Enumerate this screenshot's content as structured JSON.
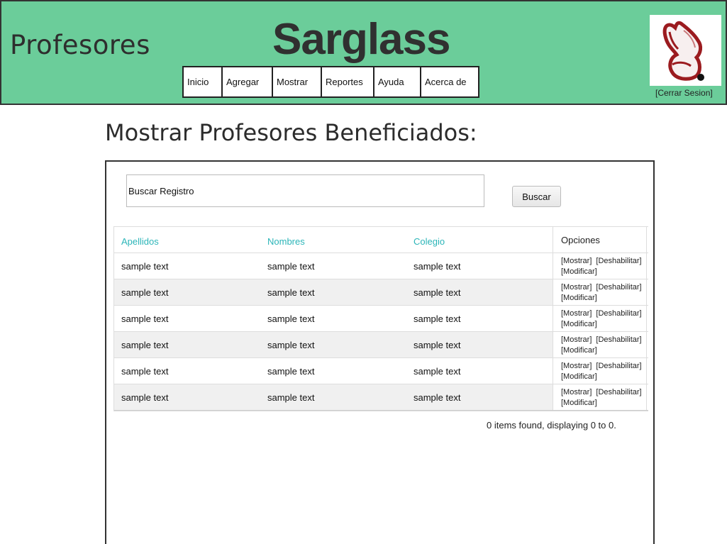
{
  "header": {
    "section_title": "Profesores",
    "brand": "Sarglass",
    "logout": "[Cerrar Sesion]",
    "nav": [
      {
        "label": "Inicio"
      },
      {
        "label": "Agregar"
      },
      {
        "label": "Mostrar"
      },
      {
        "label": "Reportes"
      },
      {
        "label": "Ayuda"
      },
      {
        "label": "Acerca de"
      }
    ],
    "logo_color": "#9b1b1f",
    "header_bg": "#6bcd9a"
  },
  "main": {
    "title": "Mostrar Profesores Beneficiados:",
    "search": {
      "value": "Buscar Registro",
      "button": "Buscar"
    },
    "table": {
      "columns": [
        "Apellidos",
        "Nombres",
        "Colegio"
      ],
      "options_header": "Opciones",
      "option_links": [
        "[Mostrar]",
        "[Deshabilitar]",
        "[Modificar]"
      ],
      "rows": [
        [
          "sample text",
          "sample text",
          "sample text"
        ],
        [
          "sample text",
          "sample text",
          "sample text"
        ],
        [
          "sample text",
          "sample text",
          "sample text"
        ],
        [
          "sample text",
          "sample text",
          "sample text"
        ],
        [
          "sample text",
          "sample text",
          "sample text"
        ],
        [
          "sample text",
          "sample text",
          "sample text"
        ]
      ]
    },
    "footer": "0 items found, displaying 0 to 0."
  }
}
